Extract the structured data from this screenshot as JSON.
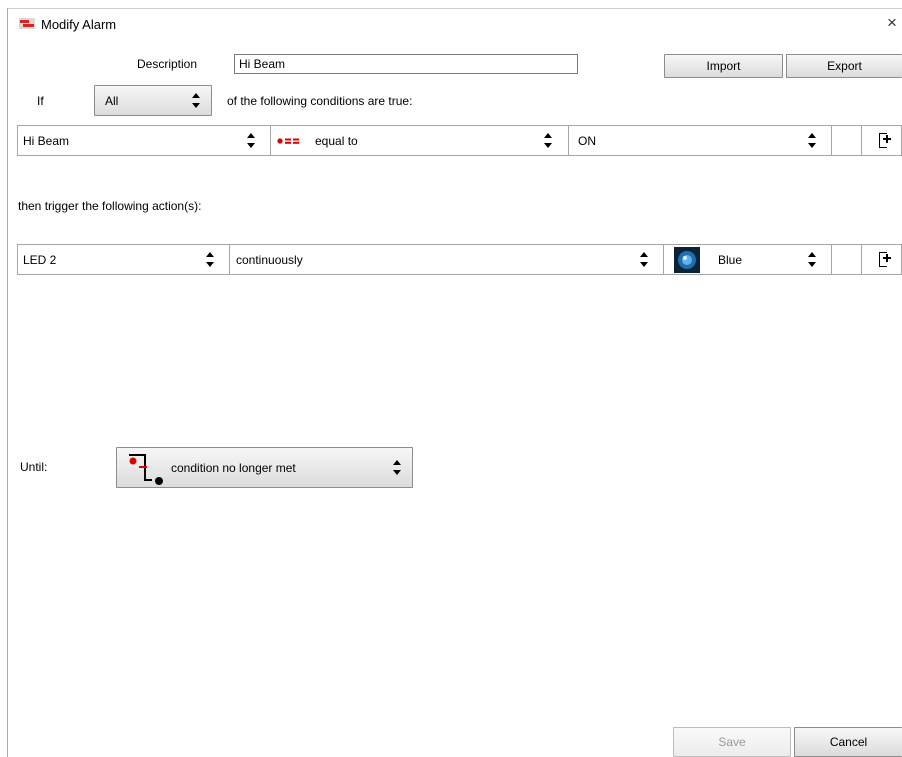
{
  "window": {
    "title": "Modify Alarm",
    "close_symbol": "×"
  },
  "top": {
    "description_label": "Description",
    "description_value": "Hi Beam",
    "import_label": "Import",
    "export_label": "Export"
  },
  "if_row": {
    "if_label": "If",
    "match_value": "All",
    "suffix": "of the following conditions are true:"
  },
  "condition": {
    "channel": "Hi Beam",
    "operator_symbol": "●==",
    "operator": "equal to",
    "value": "ON"
  },
  "then_label": "then trigger the following action(s):",
  "action": {
    "target": "LED 2",
    "mode": "continuously",
    "color_name": "Blue",
    "color_swatch": "#1f6fb0"
  },
  "until": {
    "label": "Until:",
    "value": "condition no longer met"
  },
  "footer": {
    "save_label": "Save",
    "cancel_label": "Cancel"
  },
  "colors": {
    "operator_red": "#e00000",
    "border": "#a6a6a6"
  }
}
